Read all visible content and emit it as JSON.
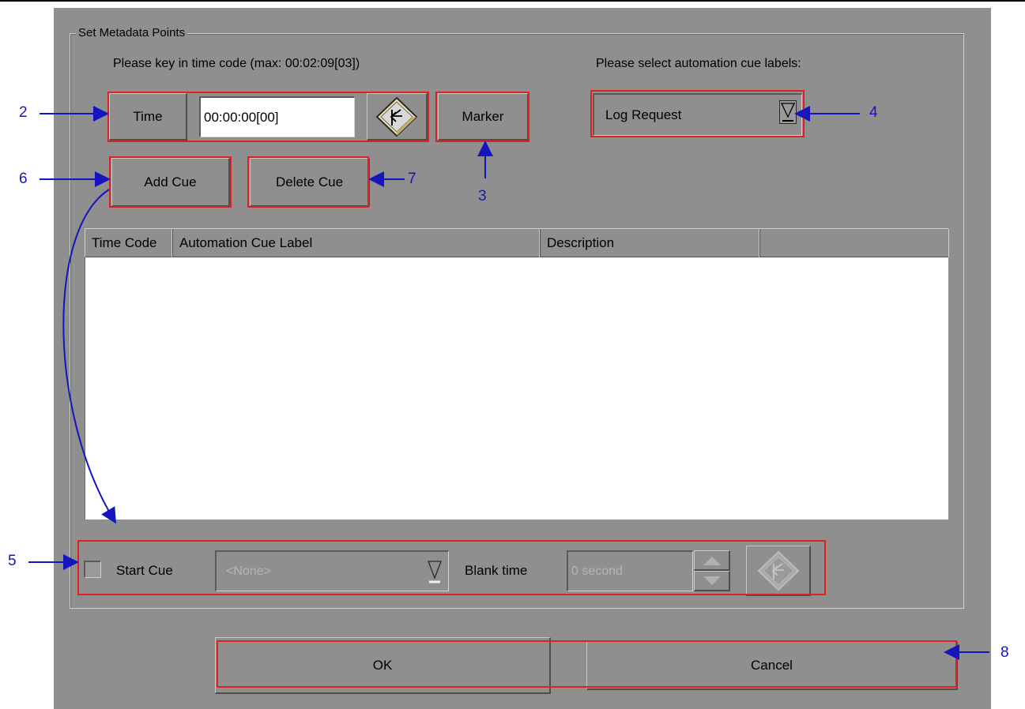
{
  "dialog": {
    "group_title": "Set Metadata Points",
    "time_instruction": "Please key in time code (max: 00:02:09[03])",
    "cue_instruction": "Please select automation cue labels:"
  },
  "time_section": {
    "time_button_label": "Time",
    "time_value": "00:00:00[00]",
    "apply_icon": "diamond-arrow-icon",
    "marker_button_label": "Marker"
  },
  "cue_label_dropdown": {
    "selected": "Log Request",
    "arrow_icon": "dropdown-arrow-icon"
  },
  "cue_buttons": {
    "add_label": "Add Cue",
    "delete_label": "Delete Cue"
  },
  "cue_table": {
    "columns": [
      "Time Code",
      "Automation Cue Label",
      "Description",
      ""
    ],
    "rows": []
  },
  "start_cue": {
    "checkbox_label": "Start Cue",
    "checked": false,
    "select_value": "<None>",
    "blank_time_label": "Blank time",
    "blank_time_value": "0 second"
  },
  "footer": {
    "ok_label": "OK",
    "cancel_label": "Cancel"
  },
  "annotations": {
    "n2": "2",
    "n3": "3",
    "n4": "4",
    "n5": "5",
    "n6": "6",
    "n7": "7",
    "n8": "8"
  },
  "colors": {
    "dialog_bg": "#8f8f8f",
    "highlight_red": "#e02020",
    "annotation_blue": "#1515c0",
    "table_bg": "#ffffff"
  }
}
